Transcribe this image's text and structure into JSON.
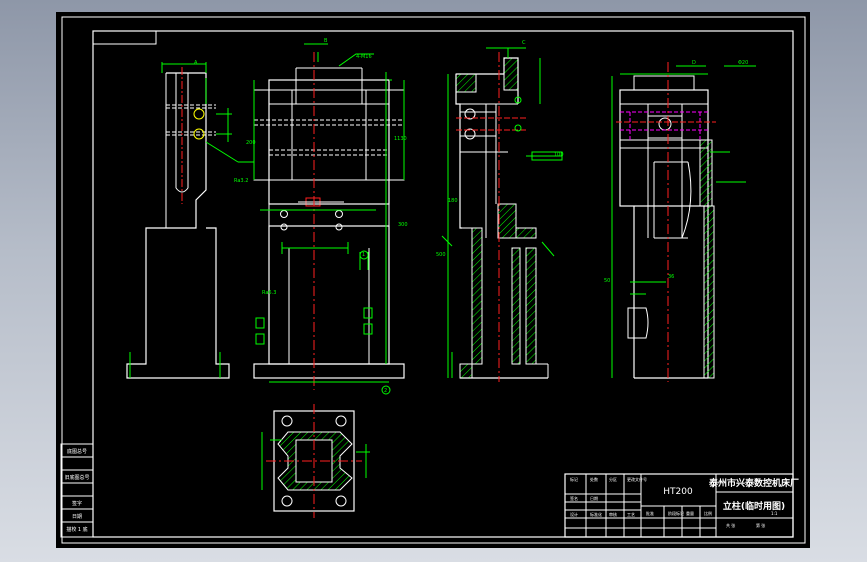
{
  "drawing": {
    "material": "HT200",
    "company": "泰州市兴泰数控机床厂",
    "part_name": "立柱(临时用图)",
    "side_table_labels": [
      "底图总号",
      "",
      "旧底图总号",
      "",
      "签字",
      "日期",
      "描校 1 底"
    ],
    "title_block_small_labels": [
      "标记",
      "处数",
      "分区",
      "更改文件号",
      "签名",
      "日期",
      "设计",
      "标准化",
      "审核",
      "工艺",
      "批准",
      "阶段标记",
      "重量",
      "比例",
      "共 张",
      "第 张",
      "1:1"
    ],
    "dimension_labels": [
      "A",
      "B",
      "C",
      "D",
      "1",
      "2",
      "Ra3.2",
      "Ra6.3",
      "4-M16",
      "Φ20",
      "300",
      "1130",
      "500",
      "180",
      "200",
      "100",
      "50",
      "36"
    ]
  },
  "colors": {
    "background": "#000000",
    "frame": "#ffffff",
    "outline": "#ffffff",
    "dimension": "#00ff00",
    "centerline": "#ff2020",
    "hidden": "#ff00ff",
    "hatch": "#00ff00",
    "cyan": "#00ffff",
    "yellow": "#ffff00"
  }
}
